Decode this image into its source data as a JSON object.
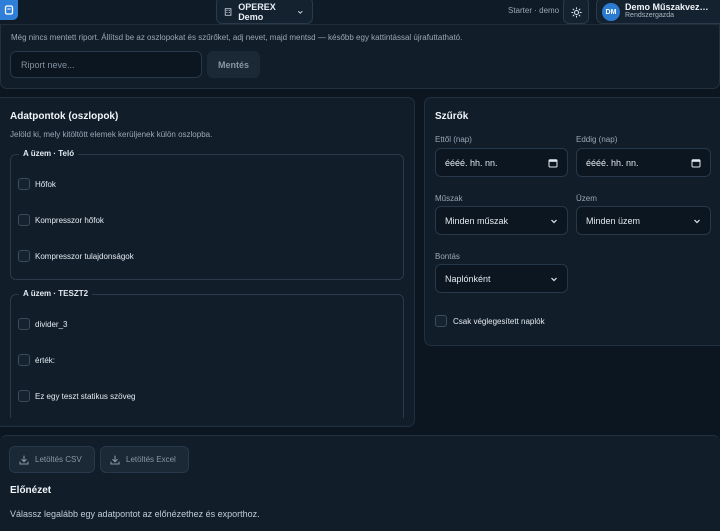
{
  "topbar": {
    "tenant_name": "OPEREX Demo",
    "plan_label": "Starter · demo",
    "user_initials": "DM",
    "user_name": "Demo Műszakvez…",
    "user_role": "Rendszergazda"
  },
  "save": {
    "info": "Még nincs mentett riport. Állítsd be az oszlopokat és szűrőket, adj nevet, majd mentsd — később egy kattintással újrafuttatható.",
    "name_placeholder": "Riport neve...",
    "save_label": "Mentés"
  },
  "datapoints": {
    "title": "Adatpontok (oszlopok)",
    "subtitle": "Jelöld ki, mely kitöltött elemek kerüljenek külön oszlopba.",
    "groups": [
      {
        "label": "A üzem · Teló",
        "items": [
          "Hőfok",
          "Kompresszor hőfok",
          "Kompresszor tulajdonságok"
        ]
      },
      {
        "label": "A üzem · TESZT2",
        "items": [
          "divider_3",
          "érték:",
          "Ez egy teszt statikus szöveg"
        ]
      }
    ]
  },
  "filters": {
    "title": "Szűrők",
    "from_label": "Ettől (nap)",
    "from_value": "éééé. hh. nn.",
    "to_label": "Eddig (nap)",
    "to_value": "éééé. hh. nn.",
    "shift_label": "Műszak",
    "shift_value": "Minden műszak",
    "plant_label": "Üzem",
    "plant_value": "Minden üzem",
    "breakdown_label": "Bontás",
    "breakdown_value": "Naplónként",
    "only_final_label": "Csak véglegesített naplók"
  },
  "export": {
    "csv_label": "Letöltés CSV",
    "excel_label": "Letöltés Excel",
    "preview_title": "Előnézet",
    "preview_empty": "Válassz legalább egy adatpontot az előnézethez és exporthoz."
  },
  "colors": {
    "background": "#0b1620",
    "panel": "#111e2a",
    "accent": "#2f7fd8"
  }
}
